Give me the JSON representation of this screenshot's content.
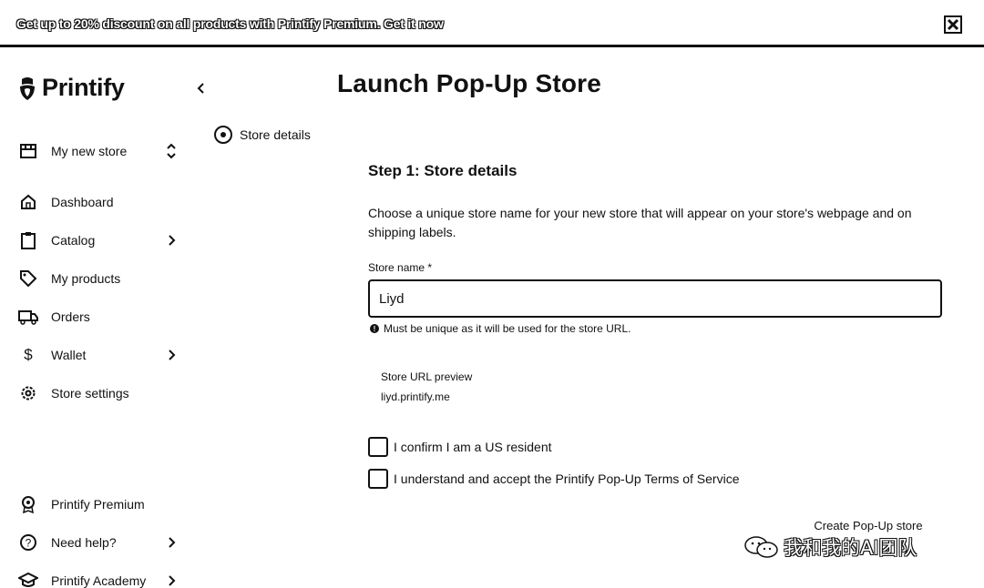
{
  "banner": {
    "text": "Get up to 20% discount on all products with Printify Premium.",
    "link": "Get it now"
  },
  "brand": {
    "name": "Printify"
  },
  "sidebar": {
    "store_selector": "My new store",
    "items": [
      {
        "label": "Dashboard",
        "icon": "home-icon"
      },
      {
        "label": "Catalog",
        "icon": "clipboard-icon"
      },
      {
        "label": "My products",
        "icon": "tag-icon"
      },
      {
        "label": "Orders",
        "icon": "truck-icon"
      },
      {
        "label": "Wallet",
        "icon": "dollar-icon"
      },
      {
        "label": "Store settings",
        "icon": "gear-icon"
      }
    ],
    "bottom_items": [
      {
        "label": "Printify Premium",
        "icon": "premium-badge-icon"
      },
      {
        "label": "Need help?",
        "icon": "help-icon"
      },
      {
        "label": "Printify Academy",
        "icon": "graduation-cap-icon"
      }
    ]
  },
  "stepper": {
    "current_step": "Store details"
  },
  "main": {
    "title": "Launch Pop-Up Store",
    "step_title": "Step 1: Store details",
    "description": "Choose a unique store name for your new store that will appear on your store's webpage and on shipping labels.",
    "store_name_label": "Store name *",
    "store_name_value": "Liyd",
    "hint": "Must be unique as it will be used for the store URL.",
    "url_preview_label": "Store URL preview",
    "url_preview_value": "liyd.printify.me",
    "checkbox_resident": "I confirm I am a US resident",
    "checkbox_terms": "I understand and accept the Printify Pop-Up  Terms of Service",
    "create_button": "Create Pop-Up store"
  },
  "watermark": "我和我的AI团队",
  "colors": {
    "text": "#111111",
    "background": "#ffffff"
  }
}
